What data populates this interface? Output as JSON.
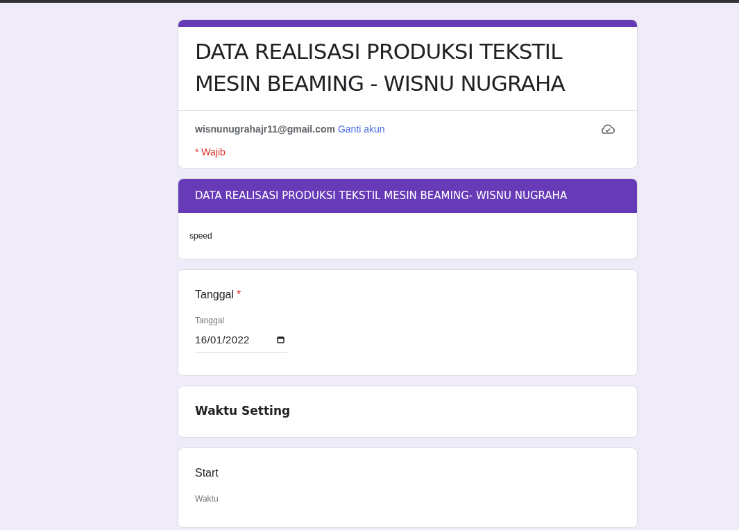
{
  "form": {
    "title": "DATA REALISASI PRODUKSI TEKSTIL MESIN BEAMING - WISNU NUGRAHA",
    "account": "wisnunugrahajr11@gmail.com",
    "switch_account": "Ganti akun",
    "required_note": "* Wajib"
  },
  "section": {
    "title": "DATA REALISASI PRODUKSI TEKSTIL MESIN BEAMING- WISNU NUGRAHA",
    "description": "speed"
  },
  "questions": [
    {
      "kind": "date",
      "title": "Tanggal",
      "required_mark": "*",
      "field_label": "Tanggal",
      "value": "16/01/2022"
    },
    {
      "kind": "heading",
      "title": "Waktu Setting"
    },
    {
      "kind": "time",
      "title": "Start",
      "field_label": "Waktu"
    }
  ]
}
